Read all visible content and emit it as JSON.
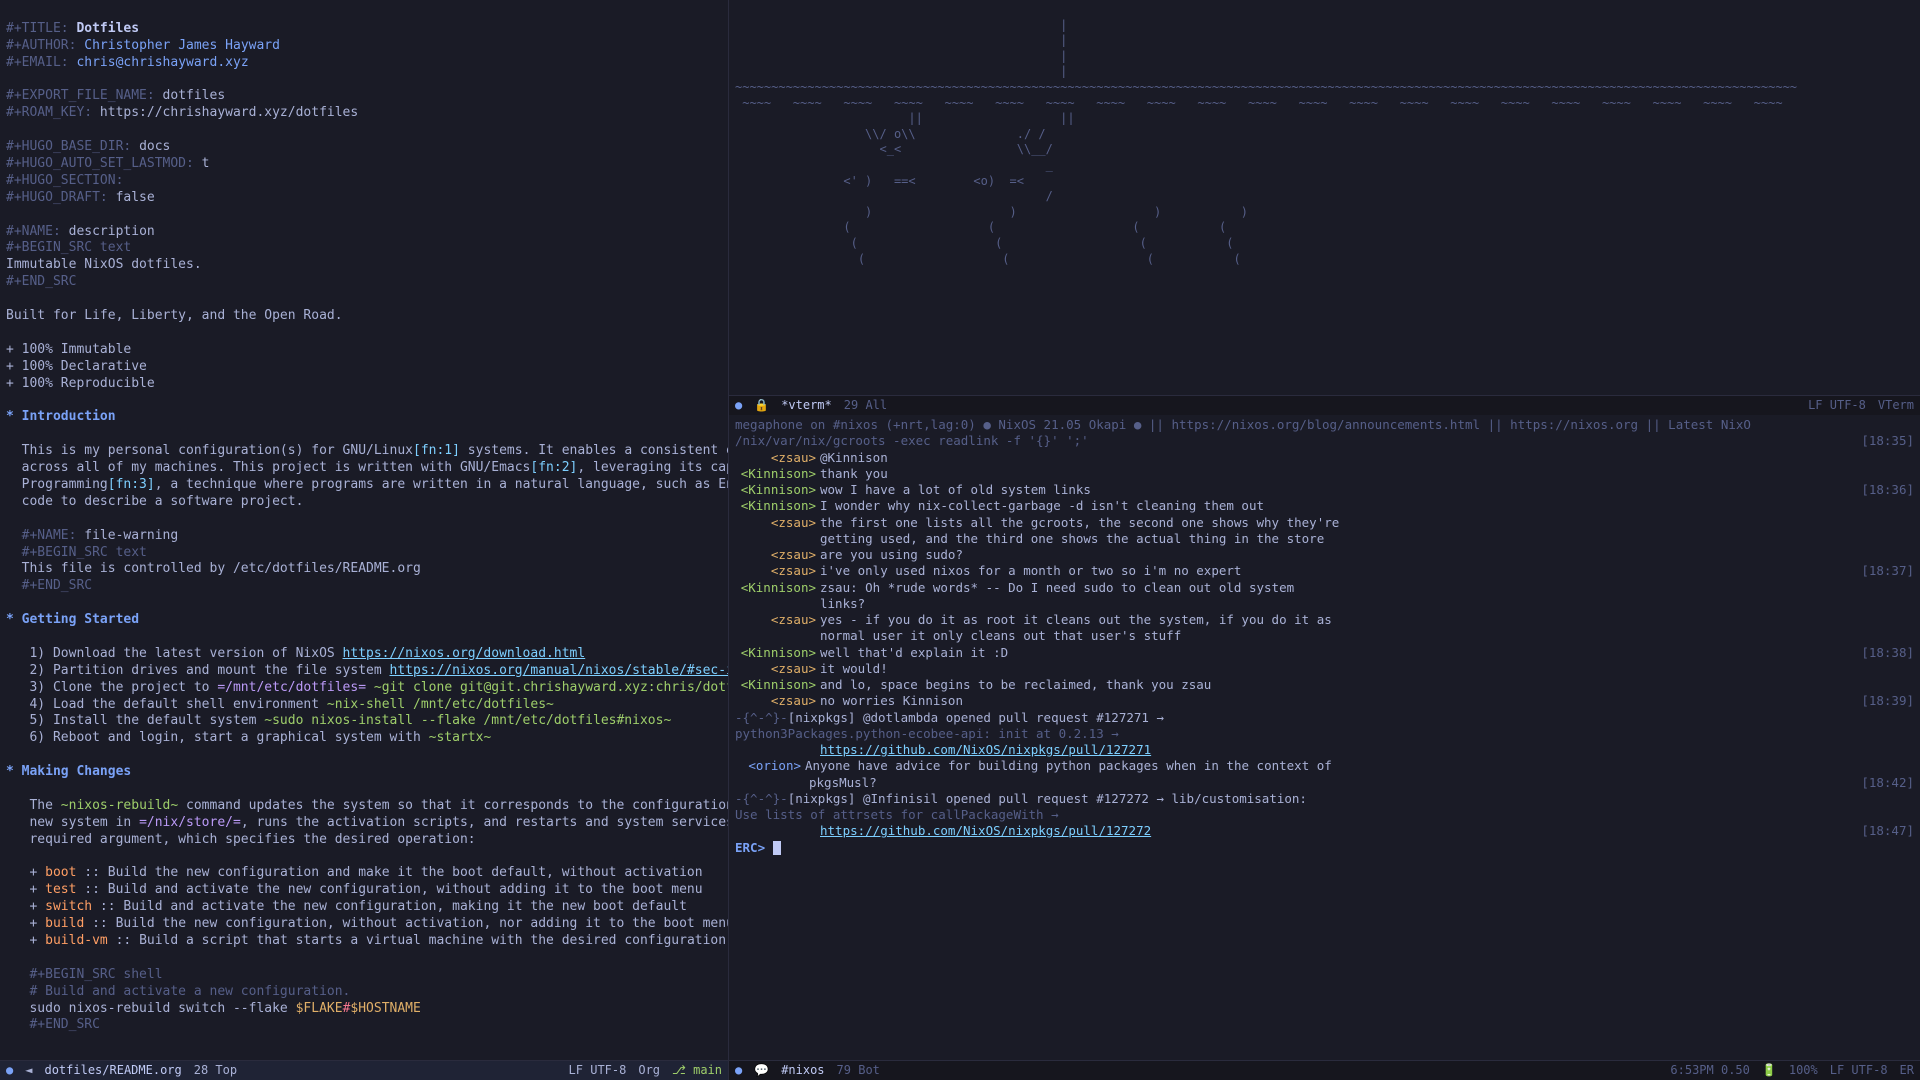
{
  "editor": {
    "header": {
      "title_kw": "#+TITLE:",
      "title_val": "Dotfiles",
      "author_kw": "#+AUTHOR:",
      "author_val": "Christopher James Hayward",
      "email_kw": "#+EMAIL:",
      "email_val": "chris@chrishayward.xyz",
      "export_kw": "#+EXPORT_FILE_NAME:",
      "export_val": "dotfiles",
      "roam_kw": "#+ROAM_KEY:",
      "roam_val": "https://chrishayward.xyz/dotfiles",
      "hugo_base_kw": "#+HUGO_BASE_DIR:",
      "hugo_base_val": "docs",
      "hugo_lastmod_kw": "#+HUGO_AUTO_SET_LASTMOD:",
      "hugo_lastmod_val": "t",
      "hugo_section_kw": "#+HUGO_SECTION:",
      "hugo_draft_kw": "#+HUGO_DRAFT:",
      "hugo_draft_val": "false",
      "name_kw": "#+NAME:",
      "name_val": "description",
      "begin_src": "#+BEGIN_SRC text",
      "src_content": "Immutable NixOS dotfiles.",
      "end_src": "#+END_SRC"
    },
    "tagline": "Built for Life, Liberty, and the Open Road.",
    "features": [
      "+ 100% Immutable",
      "+ 100% Declarative",
      "+ 100% Reproducible"
    ],
    "intro": {
      "heading": "* Introduction",
      "p1a": "  This is my personal configuration(s) for GNU/Linux",
      "fn1": "[fn:1]",
      "p1b": " systems. It enables a consistent experience and computing environment",
      "p2a": "  across all of my machines. This project is written with GNU/Emacs",
      "fn2": "[fn:2]",
      "p2b": ", leveraging its capabilities for Literate",
      "p3a": "  Programming",
      "fn3": "[fn:3]",
      "p3b": ", a technique where programs are written in a natural language, such as English, interspersed with snippets of",
      "p4": "  code to describe a software project.",
      "name2_kw": "  #+NAME:",
      "name2_val": "file-warning",
      "begin2": "  #+BEGIN_SRC text",
      "src2": "  This file is controlled by /etc/dotfiles/README.org",
      "end2": "  #+END_SRC"
    },
    "getting_started": {
      "heading": "* Getting Started",
      "s1a": "   1) Download the latest version of NixOS ",
      "s1_link": "https://nixos.org/download.html",
      "s2a": "   2) Partition drives and mount the file system ",
      "s2_link": "https://nixos.org/manual/nixos/stable/#sec-installation-partitioning",
      "s3a": "   3) Clone the project to ",
      "s3_code": "=/mnt/etc/dotfiles=",
      "s3_verb": " ~git clone git@git.chrishayward.xyz:chris/dotfiles /mnt/etc/dotfiles~",
      "s4a": "   4) Load the default shell environment ",
      "s4_verb": "~nix-shell /mnt/etc/dotfiles~",
      "s5a": "   5) Install the default system ",
      "s5_verb": "~sudo nixos-install --flake /mnt/etc/dotfiles#nixos~",
      "s6a": "   6) Reboot and login, start a graphical system with ",
      "s6_verb": "~startx~"
    },
    "making_changes": {
      "heading": "* Making Changes",
      "p1a": "   The ",
      "p1_verb": "~nixos-rebuild~",
      "p1b": " command updates the system so that it corresponds to the configuration specified in the module. It builds the",
      "p2a": "   new system in ",
      "p2_code": "=/nix/store/=",
      "p2b": ", runs the activation scripts, and restarts and system services (if needed). The command has one",
      "p3": "   required argument, which specifies the desired operation:",
      "b1_kw": "boot",
      "b1_txt": " :: Build the new configuration and make it the boot default, without activation",
      "b2_kw": "test",
      "b2_txt": " :: Build and activate the new configuration, without adding it to the boot menu",
      "b3_kw": "switch",
      "b3_txt": " :: Build and activate the new configuration, making it the new boot default",
      "b4_kw": "build",
      "b4_txt": " :: Build the new configuration, without activation, nor adding it to the boot menu",
      "b5_kw": "build-vm",
      "b5_txt": " :: Build a script that starts a virtual machine with the desired configuration",
      "src_begin": "   #+BEGIN_SRC shell",
      "src_comment": "   # Build and activate a new configuration.",
      "src_cmd_a": "   sudo nixos-rebuild switch --flake ",
      "src_var1": "$FLAKE",
      "src_hash": "#",
      "src_var2": "$HOSTNAME",
      "src_end": "   #+END_SRC"
    }
  },
  "modeline_left": {
    "dot": "●",
    "file": "dotfiles/README.org",
    "pos": "28 Top",
    "encoding": "LF UTF-8",
    "mode": "Org",
    "branch_icon": "⎇",
    "branch": "main"
  },
  "vterm": {
    "tildes": "~~~~~~~~~~~~~~~~~~~~~~~~~~~~~~~~~~~~~~~~~~~~~~~~~~~~~~~~~~~~~~~~~~~~~~~~~~~~~~~~~~~~~~~~~~~~~~~~~~~~~~~~~~~~~~~~~~~~~~~~~~~~~~~~~~~~~~~~~~~~~~~~~~~",
    "modeline": {
      "dot": "●",
      "lock": "🔒",
      "name": "*vterm*",
      "pos": "29 All",
      "encoding": "LF UTF-8",
      "mode": "VTerm"
    }
  },
  "irc": {
    "topic1": "megaphone on #nixos (+nrt,lag:0)  ●  NixOS 21.05 Okapi  ●  || https://nixos.org/blog/announcements.html || https://nixos.org || Latest NixO",
    "topic2": "              /nix/var/nix/gcroots -exec readlink -f '{}' ';'",
    "topic2_time": "[18:35]",
    "lines": [
      {
        "nick": "<zsau>",
        "msg": "@Kinnison",
        "nickcls": "irc-nick"
      },
      {
        "nick": "<Kinnison>",
        "msg": "thank you",
        "nickcls": "irc-nick2"
      },
      {
        "nick": "<Kinnison>",
        "msg": "wow I have a lot of old system links",
        "time": "[18:36]",
        "nickcls": "irc-nick2"
      },
      {
        "nick": "<Kinnison>",
        "msg": "I wonder why nix-collect-garbage -d isn't cleaning them out",
        "nickcls": "irc-nick2"
      },
      {
        "nick": "<zsau>",
        "msg": "the first one lists all the gcroots, the second one shows why they're",
        "nickcls": "irc-nick"
      },
      {
        "nick": "",
        "msg": "getting used, and the third one shows the actual thing in the store",
        "nickcls": ""
      },
      {
        "nick": "<zsau>",
        "msg": "are you using sudo?",
        "nickcls": "irc-nick"
      },
      {
        "nick": "<zsau>",
        "msg": "i've only used nixos for a month or two so i'm no expert",
        "time": "[18:37]",
        "nickcls": "irc-nick"
      },
      {
        "nick": "<Kinnison>",
        "msg": "zsau: Oh *rude words* -- Do I need sudo to clean out old system",
        "nickcls": "irc-nick2"
      },
      {
        "nick": "",
        "msg": "links?",
        "nickcls": ""
      },
      {
        "nick": "<zsau>",
        "msg": "yes - if you do it as root it cleans out the system, if you do it as",
        "nickcls": "irc-nick"
      },
      {
        "nick": "",
        "msg": "normal user it only cleans out that user's stuff",
        "nickcls": ""
      },
      {
        "nick": "<Kinnison>",
        "msg": "well that'd explain it :D",
        "time": "[18:38]",
        "nickcls": "irc-nick2"
      },
      {
        "nick": "<zsau>",
        "msg": "it would!",
        "nickcls": "irc-nick"
      },
      {
        "nick": "<Kinnison>",
        "msg": "and lo, space begins to be reclaimed, thank you zsau",
        "nickcls": "irc-nick2"
      },
      {
        "nick": "<zsau>",
        "msg": "no worries Kinnison",
        "time": "[18:39]",
        "nickcls": "irc-nick"
      }
    ],
    "pr1_prefix": "-{^-^}-",
    "pr1_text": " [nixpkgs] @dotlambda opened pull request #127271 →",
    "pr1_text2": "          python3Packages.python-ecobee-api: init at 0.2.13 →",
    "pr1_link": "https://github.com/NixOS/nixpkgs/pull/127271",
    "orion_nick": "<orion>",
    "orion_msg": "Anyone have advice for building python packages when in the context of",
    "orion_msg2": "pkgsMusl?",
    "orion_time": "[18:42]",
    "pr2_prefix": "-{^-^}-",
    "pr2_text": " [nixpkgs] @Infinisil opened pull request #127272 → lib/customisation:",
    "pr2_text2": "          Use lists of attrsets for callPackageWith →",
    "pr2_link": "https://github.com/NixOS/nixpkgs/pull/127272",
    "pr2_time": "[18:47]",
    "prompt": "ERC>",
    "modeline": {
      "dot": "●",
      "chat_icon": "💬",
      "name": "#nixos",
      "pos": "79 Bot",
      "time": "6:53PM 0.50",
      "battery": "100%",
      "encoding": "LF UTF-8",
      "mode": "ER"
    }
  }
}
